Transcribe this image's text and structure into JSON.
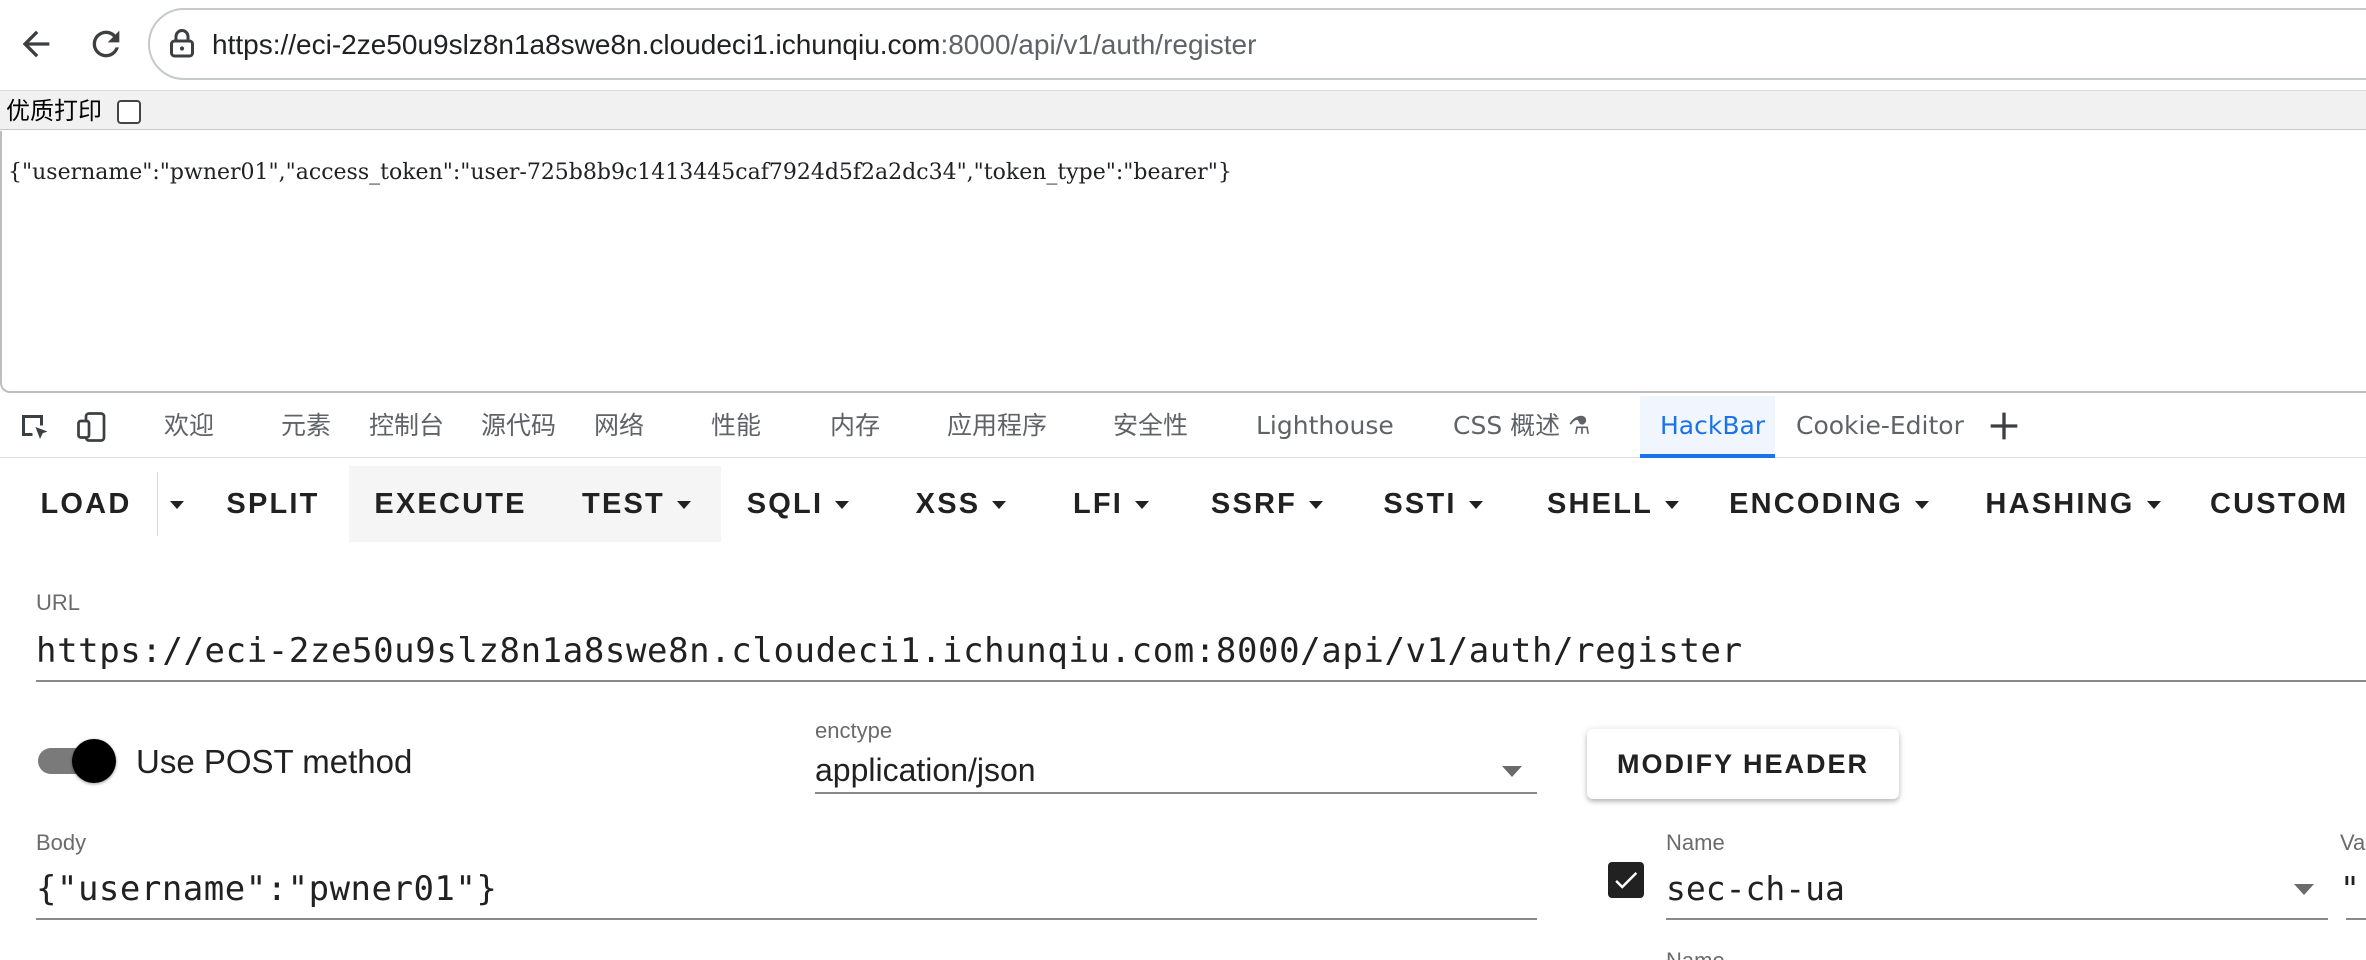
{
  "browser": {
    "url_host": "https://eci-2ze50u9slz8n1a8swe8n.cloudeci1.ichunqiu.com",
    "url_path": ":8000/api/v1/auth/register",
    "icons": {
      "back": "back-arrow-icon",
      "reload": "reload-icon",
      "site_info": "site-info-icon"
    }
  },
  "print_option": {
    "label": "优质打印",
    "checked": false
  },
  "page": {
    "response_text": "{\"username\":\"pwner01\",\"access_token\":\"user-725b8b9c1413445caf7924d5f2a2dc34\",\"token_type\":\"bearer\"}"
  },
  "devtools": {
    "tabs": [
      "欢迎",
      "元素",
      "控制台",
      "源代码",
      "网络",
      "性能",
      "内存",
      "应用程序",
      "安全性",
      "Lighthouse",
      "CSS 概述 ⚗",
      "HackBar",
      "Cookie-Editor"
    ],
    "active_tab": "HackBar",
    "accent_color": "#1a73e8",
    "icons": {
      "inspect": "inspect-element-icon",
      "device": "device-toolbar-icon",
      "more_tabs": "plus-icon"
    }
  },
  "hackbar": {
    "menu": {
      "load": "LOAD",
      "split": "SPLIT",
      "execute": "EXECUTE",
      "test": "TEST",
      "sqli": "SQLI",
      "xss": "XSS",
      "lfi": "LFI",
      "ssrf": "SSRF",
      "ssti": "SSTI",
      "shell": "SHELL",
      "encoding": "ENCODING",
      "hashing": "HASHING",
      "custom": "CUSTOM"
    },
    "url_label": "URL",
    "url_value": "https://eci-2ze50u9slz8n1a8swe8n.cloudeci1.ichunqiu.com:8000/api/v1/auth/register",
    "post_toggle": {
      "label": "Use POST method",
      "on": true
    },
    "enctype": {
      "label": "enctype",
      "value": "application/json"
    },
    "modify_header_label": "MODIFY HEADER",
    "body": {
      "label": "Body",
      "value": "{\"username\":\"pwner01\"}"
    },
    "headers": [
      {
        "enabled": true,
        "name_label": "Name",
        "name": "sec-ch-ua",
        "value_label": "Va",
        "value": "\""
      }
    ],
    "next_header_label": "Name"
  }
}
